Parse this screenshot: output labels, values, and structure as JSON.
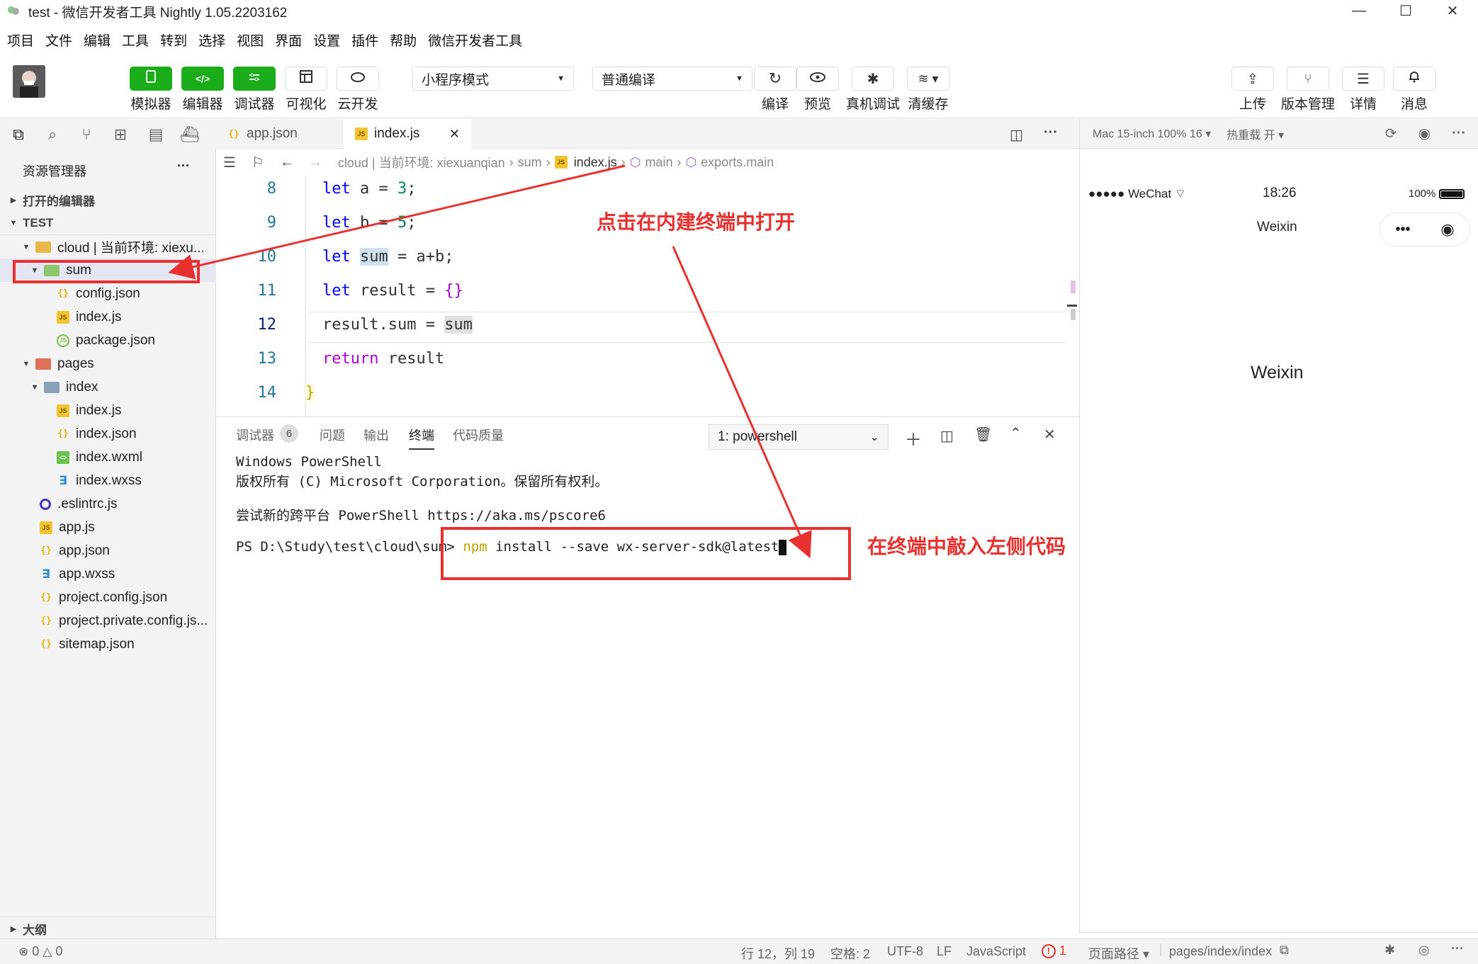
{
  "window": {
    "title": "test - 微信开发者工具 Nightly 1.05.2203162"
  },
  "menu": [
    "项目",
    "文件",
    "编辑",
    "工具",
    "转到",
    "选择",
    "视图",
    "界面",
    "设置",
    "插件",
    "帮助",
    "微信开发者工具"
  ],
  "toolbar": {
    "simulator": "模拟器",
    "editor": "编辑器",
    "debugger": "调试器",
    "visual": "可视化",
    "cloud": "云开发",
    "mode_select": "小程序模式",
    "compile_select": "普通编译",
    "compile": "编译",
    "preview": "预览",
    "remote_debug": "真机调试",
    "clear_cache": "清缓存",
    "upload": "上传",
    "version": "版本管理",
    "details": "详情",
    "messages": "消息"
  },
  "sidebar": {
    "title": "资源管理器",
    "more": "···",
    "open_editors": "打开的编辑器",
    "project": "TEST",
    "tree": [
      {
        "label": "cloud | 当前环境: xiexu...",
        "type": "folder-cloud"
      },
      {
        "label": "sum",
        "type": "folder-green"
      },
      {
        "label": "config.json",
        "type": "json"
      },
      {
        "label": "index.js",
        "type": "js"
      },
      {
        "label": "package.json",
        "type": "pkg"
      },
      {
        "label": "pages",
        "type": "folder-red"
      },
      {
        "label": "index",
        "type": "folder-blue"
      },
      {
        "label": "index.js",
        "type": "js"
      },
      {
        "label": "index.json",
        "type": "json"
      },
      {
        "label": "index.wxml",
        "type": "wxml"
      },
      {
        "label": "index.wxss",
        "type": "wxss"
      },
      {
        "label": ".eslintrc.js",
        "type": "eslint"
      },
      {
        "label": "app.js",
        "type": "js"
      },
      {
        "label": "app.json",
        "type": "json"
      },
      {
        "label": "app.wxss",
        "type": "wxss"
      },
      {
        "label": "project.config.json",
        "type": "json"
      },
      {
        "label": "project.private.config.js...",
        "type": "json"
      },
      {
        "label": "sitemap.json",
        "type": "json"
      }
    ],
    "outline": "大纲"
  },
  "tabs": [
    {
      "label": "app.json"
    },
    {
      "label": "index.js"
    }
  ],
  "breadcrumb": [
    "cloud | 当前环境: xiexuanqian",
    "sum",
    "index.js",
    "main",
    "exports.main"
  ],
  "code": [
    {
      "n": "8",
      "text": "let a = 3;"
    },
    {
      "n": "9",
      "text": "let b = 5;"
    },
    {
      "n": "10",
      "text": "let sum = a+b;"
    },
    {
      "n": "11",
      "text": "let result = {}"
    },
    {
      "n": "12",
      "text": "result.sum = sum"
    },
    {
      "n": "13",
      "text": "return result"
    },
    {
      "n": "14",
      "text": "}"
    }
  ],
  "panel": {
    "tabs": [
      "调试器",
      "问题",
      "输出",
      "终端",
      "代码质量"
    ],
    "debugger_badge": "6",
    "terminal_select": "1: powershell",
    "lines": [
      "Windows PowerShell",
      "版权所有 (C) Microsoft Corporation。保留所有权利。",
      "",
      "尝试新的跨平台 PowerShell https://aka.ms/pscore6",
      ""
    ],
    "prompt": "PS D:\\Study\\test\\cloud\\sum>",
    "cmd_npm": "npm",
    "cmd_rest": " install --save wx-server-sdk@latest"
  },
  "simulator": {
    "device": "Mac 15-inch 100% 16 ▾",
    "hot_reload": "热重载 开 ▾",
    "carrier": "●●●●● WeChat",
    "time": "18:26",
    "battery": "100%",
    "nav_title": "Weixin",
    "page_text": "Weixin"
  },
  "status": {
    "errors": "0",
    "warnings": "0",
    "position": "行 12，列 19",
    "spaces": "空格: 2",
    "encoding": "UTF-8",
    "eol": "LF",
    "language": "JavaScript",
    "issues": "1",
    "page_path_label": "页面路径 ▾",
    "page_path": "pages/index/index"
  },
  "annotations": {
    "top": "点击在内建终端中打开",
    "bottom": "在终端中敲入左侧代码"
  },
  "colors": {
    "accent": "#1aad19",
    "annotation": "#e8312f"
  }
}
